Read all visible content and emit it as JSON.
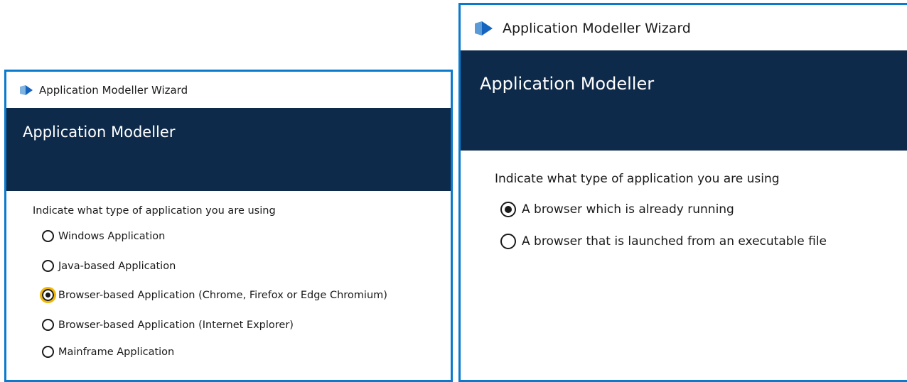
{
  "colors": {
    "window_border": "#0a7acc",
    "banner_bg": "#0e2a4a",
    "focus_ring": "#f2b705"
  },
  "left_window": {
    "title": "Application Modeller Wizard",
    "icon": "blue-prism-logo-icon",
    "banner_title": "Application Modeller",
    "prompt": "Indicate what type of application you are using",
    "options": [
      {
        "label": "Windows Application",
        "selected": false
      },
      {
        "label": "Java-based Application",
        "selected": false
      },
      {
        "label": "Browser-based Application (Chrome, Firefox or Edge Chromium)",
        "selected": true
      },
      {
        "label": "Browser-based Application (Internet Explorer)",
        "selected": false
      },
      {
        "label": "Mainframe Application",
        "selected": false
      }
    ]
  },
  "right_window": {
    "title": "Application Modeller Wizard",
    "icon": "blue-prism-logo-icon",
    "banner_title": "Application Modeller",
    "prompt": "Indicate what type of application you are using",
    "options": [
      {
        "label": "A browser which is already running",
        "selected": true
      },
      {
        "label": "A browser that is launched from an executable file",
        "selected": false
      }
    ]
  }
}
